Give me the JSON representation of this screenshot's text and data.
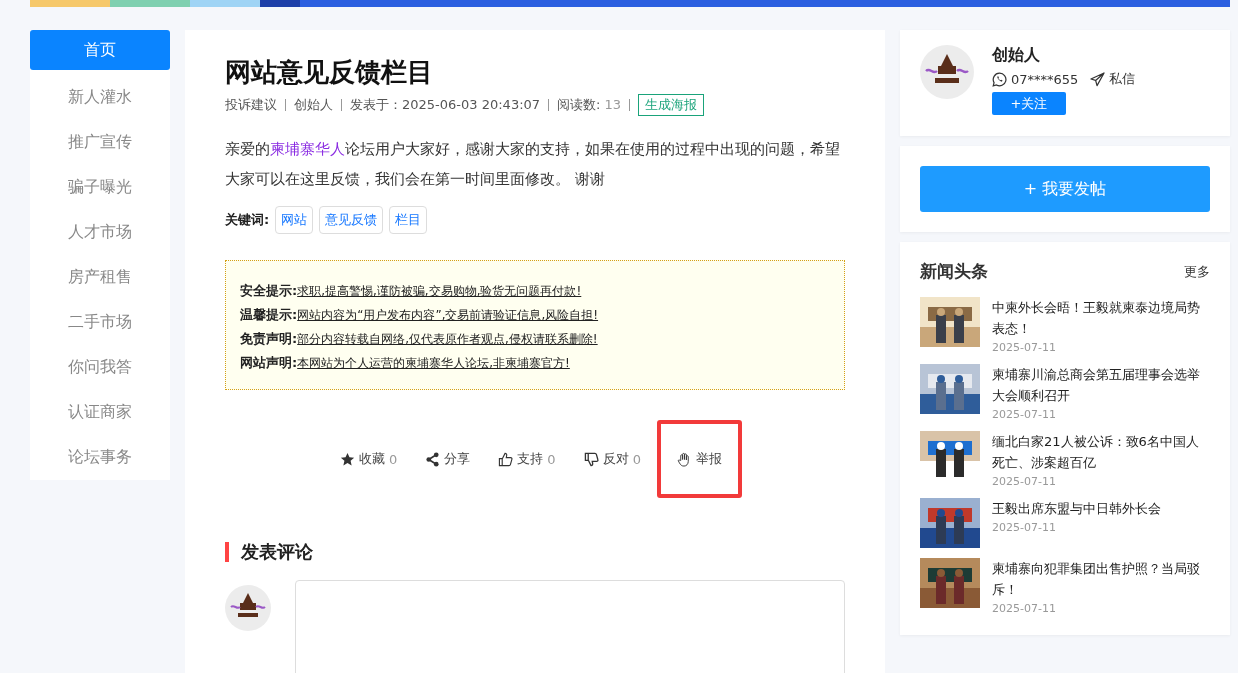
{
  "sidebar": {
    "items": [
      {
        "label": "首页",
        "selected": true
      },
      {
        "label": "新人灌水",
        "selected": false
      },
      {
        "label": "推广宣传",
        "selected": false
      },
      {
        "label": "骗子曝光",
        "selected": false
      },
      {
        "label": "人才市场",
        "selected": false
      },
      {
        "label": "房产租售",
        "selected": false
      },
      {
        "label": "二手市场",
        "selected": false
      },
      {
        "label": "你问我答",
        "selected": false
      },
      {
        "label": "认证商家",
        "selected": false
      },
      {
        "label": "论坛事务",
        "selected": false
      }
    ]
  },
  "article": {
    "title": "网站意见反馈栏目",
    "meta": {
      "category": "投诉建议",
      "author": "创始人",
      "posted": "发表于：2025-06-03 20:43:07",
      "reads_label": "阅读数:",
      "reads": "13",
      "poster_button": "生成海报"
    },
    "body": {
      "before": "亲爱的",
      "link": "柬埔寨华人",
      "after": "论坛用户大家好，感谢大家的支持，如果在使用的过程中出现的问题，希望大家可以在这里反馈，我们会在第一时间里面修改。 谢谢"
    },
    "keywords_label": "关键词:",
    "keywords": [
      "网站",
      "意见反馈",
      "栏目"
    ],
    "notices": [
      {
        "label": "安全提示:",
        "text": "求职,提高警惕,谨防被骗,交易购物,验货无问题再付款!"
      },
      {
        "label": "温馨提示:",
        "text": "网站内容为“用户发布内容”,交易前请验证信息,风险自担!"
      },
      {
        "label": "免责声明:",
        "text": "部分内容转载自网络,仅代表原作者观点,侵权请联系删除!"
      },
      {
        "label": "网站声明:",
        "text": "本网站为个人运营的柬埔寨华人论坛,非柬埔寨官方!"
      }
    ],
    "actions": [
      {
        "kind": "star",
        "label": "收藏",
        "count": "0",
        "highlighted": false
      },
      {
        "kind": "share",
        "label": "分享",
        "highlighted": false
      },
      {
        "kind": "up",
        "label": "支持",
        "count": "0",
        "highlighted": false
      },
      {
        "kind": "down",
        "label": "反对",
        "count": "0",
        "highlighted": false
      },
      {
        "kind": "hand",
        "label": "举报",
        "highlighted": true
      }
    ]
  },
  "comments": {
    "title": "发表评论"
  },
  "profile": {
    "name": "创始人",
    "phone": "07****655",
    "message": "私信",
    "follow": "+关注"
  },
  "post_button": "+ 我要发帖",
  "news": {
    "title": "新闻头条",
    "more": "更多",
    "items": [
      {
        "title": "中柬外长会晤！王毅就柬泰边境局势表态！",
        "date": "2025-07-11"
      },
      {
        "title": "柬埔寨川渝总商会第五届理事会选举大会顺利召开",
        "date": "2025-07-11"
      },
      {
        "title": "缅北白家21人被公诉：致6名中国人死亡、涉案超百亿",
        "date": "2025-07-11"
      },
      {
        "title": "王毅出席东盟与中日韩外长会",
        "date": "2025-07-11"
      },
      {
        "title": "柬埔寨向犯罪集团出售护照？当局驳斥！",
        "date": "2025-07-11"
      }
    ]
  }
}
